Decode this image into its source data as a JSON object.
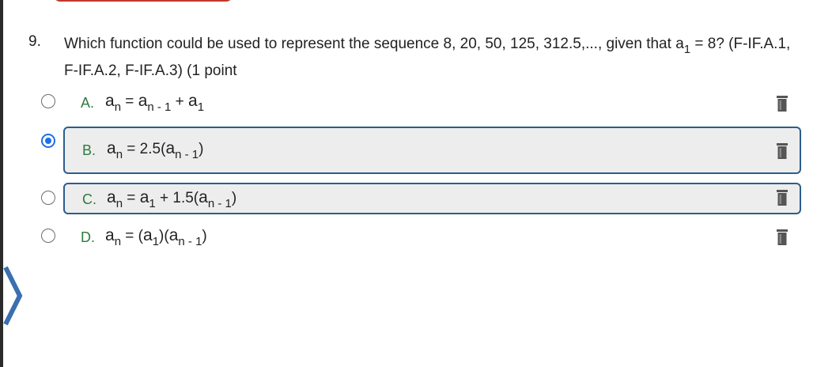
{
  "question": {
    "number": "9.",
    "text_prefix": "Which function could be used to represent the sequence 8, 20, 50, 125, 312.5,..., given that ",
    "given_var": "a",
    "given_sub": "1",
    "text_suffix": " = 8? (F-IF.A.1, F-IF.A.2, F-IF.A.3) (1 point"
  },
  "options": [
    {
      "letter": "A.",
      "selected": false,
      "parts": [
        {
          "t": "v",
          "s": "a"
        },
        {
          "t": "s",
          "s": "n"
        },
        {
          "t": "n",
          "s": " = "
        },
        {
          "t": "v",
          "s": "a"
        },
        {
          "t": "s",
          "s": "n - 1"
        },
        {
          "t": "n",
          "s": " + "
        },
        {
          "t": "v",
          "s": "a"
        },
        {
          "t": "s",
          "s": "1"
        }
      ]
    },
    {
      "letter": "B.",
      "selected": true,
      "parts": [
        {
          "t": "v",
          "s": "a"
        },
        {
          "t": "s",
          "s": "n"
        },
        {
          "t": "n",
          "s": " = 2.5("
        },
        {
          "t": "v",
          "s": "a"
        },
        {
          "t": "s",
          "s": "n - 1"
        },
        {
          "t": "n",
          "s": ")"
        }
      ]
    },
    {
      "letter": "C.",
      "selected": false,
      "parts": [
        {
          "t": "v",
          "s": "a"
        },
        {
          "t": "s",
          "s": "n"
        },
        {
          "t": "n",
          "s": " = "
        },
        {
          "t": "v",
          "s": "a"
        },
        {
          "t": "s",
          "s": "1"
        },
        {
          "t": "n",
          "s": " + 1.5("
        },
        {
          "t": "v",
          "s": "a"
        },
        {
          "t": "s",
          "s": "n - 1"
        },
        {
          "t": "n",
          "s": ")"
        }
      ]
    },
    {
      "letter": "D.",
      "selected": false,
      "parts": [
        {
          "t": "v",
          "s": "a"
        },
        {
          "t": "s",
          "s": "n"
        },
        {
          "t": "n",
          "s": " = ("
        },
        {
          "t": "v",
          "s": "a"
        },
        {
          "t": "s",
          "s": "1"
        },
        {
          "t": "n",
          "s": ")("
        },
        {
          "t": "v",
          "s": "a"
        },
        {
          "t": "s",
          "s": "n - 1"
        },
        {
          "t": "n",
          "s": ")"
        }
      ]
    }
  ],
  "colors": {
    "accent": "#1f6fe5",
    "option_border": "#2c5d8e",
    "letter": "#2f7a3f",
    "chevron": "#3a6fb0",
    "tab": "#c0392b"
  },
  "icons": {
    "trash": "trash-icon",
    "chevron": "chevron-right-icon"
  }
}
